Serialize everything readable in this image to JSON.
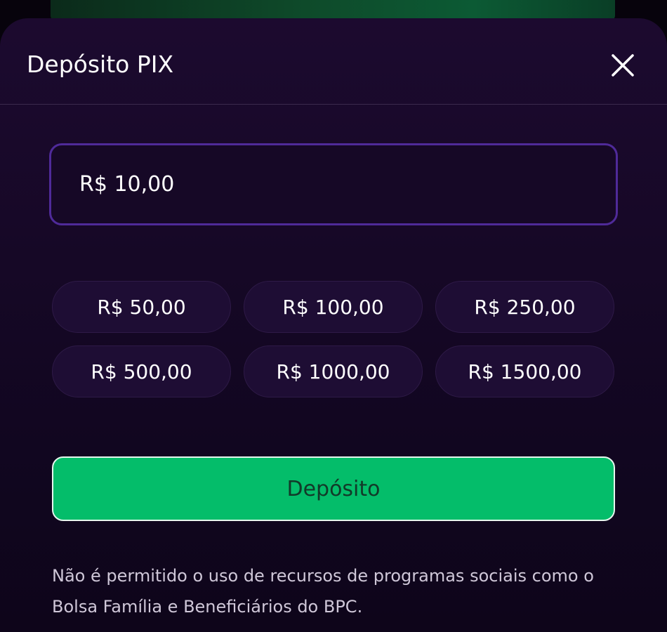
{
  "modal": {
    "title": "Depósito PIX",
    "close_icon": "close-icon"
  },
  "amount_input": {
    "value": "R$ 10,00"
  },
  "presets": [
    {
      "label": "R$ 50,00"
    },
    {
      "label": "R$ 100,00"
    },
    {
      "label": "R$ 250,00"
    },
    {
      "label": "R$ 500,00"
    },
    {
      "label": "R$ 1000,00"
    },
    {
      "label": "R$ 1500,00"
    }
  ],
  "deposit_button": {
    "label": "Depósito"
  },
  "disclaimer": "Não é permitido o uso de recursos de programas sociais como o Bolsa Família e Beneficiários do BPC.",
  "colors": {
    "modal_bg": "#160826",
    "input_border": "#4f2a99",
    "preset_bg": "#1e0d34",
    "primary_green": "#04bd6a"
  }
}
